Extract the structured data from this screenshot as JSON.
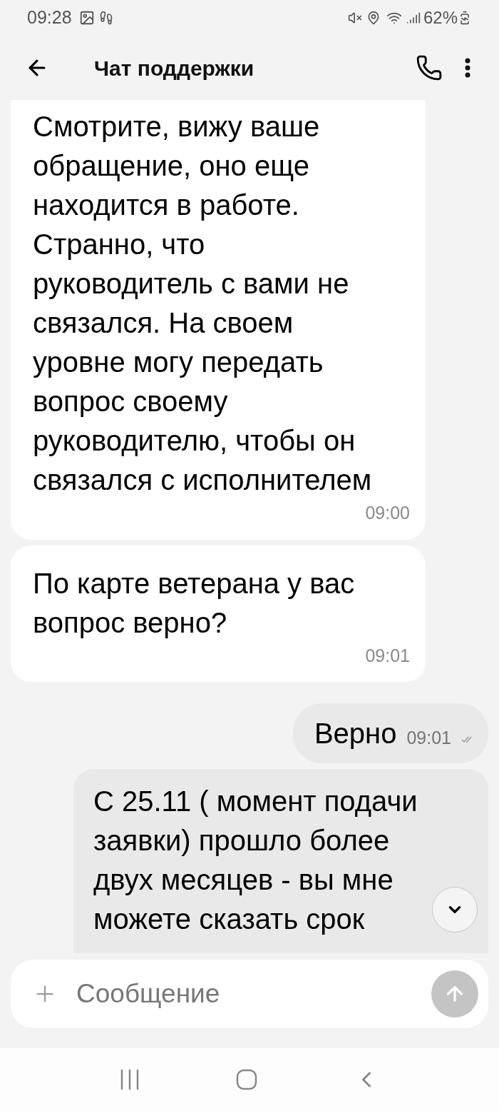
{
  "status_bar": {
    "time": "09:28",
    "battery": "62%"
  },
  "header": {
    "title": "Чат поддержки"
  },
  "messages": [
    {
      "kind": "incoming",
      "lines": [
        "Смотрите, вижу ваше",
        "обращение, оно еще",
        "находится в работе.",
        "Странно, что",
        "руководитель с вами не",
        "связался. На своем",
        "уровне могу передать",
        "вопрос своему",
        "руководителю, чтобы он",
        "связался с исполнителем"
      ],
      "time": "09:00"
    },
    {
      "kind": "incoming",
      "lines": [
        "По карте ветерана у вас",
        "вопрос верно?"
      ],
      "time": "09:01"
    },
    {
      "kind": "outgoing",
      "lines": [
        "Верно"
      ],
      "time": "09:01",
      "read": true
    },
    {
      "kind": "outgoing",
      "lines": [
        "С 25.11 ( момент подачи",
        "заявки) прошло более",
        "двух месяцев - вы мне",
        "можете сказать срок"
      ]
    }
  ],
  "composer": {
    "placeholder": "Сообщение"
  }
}
